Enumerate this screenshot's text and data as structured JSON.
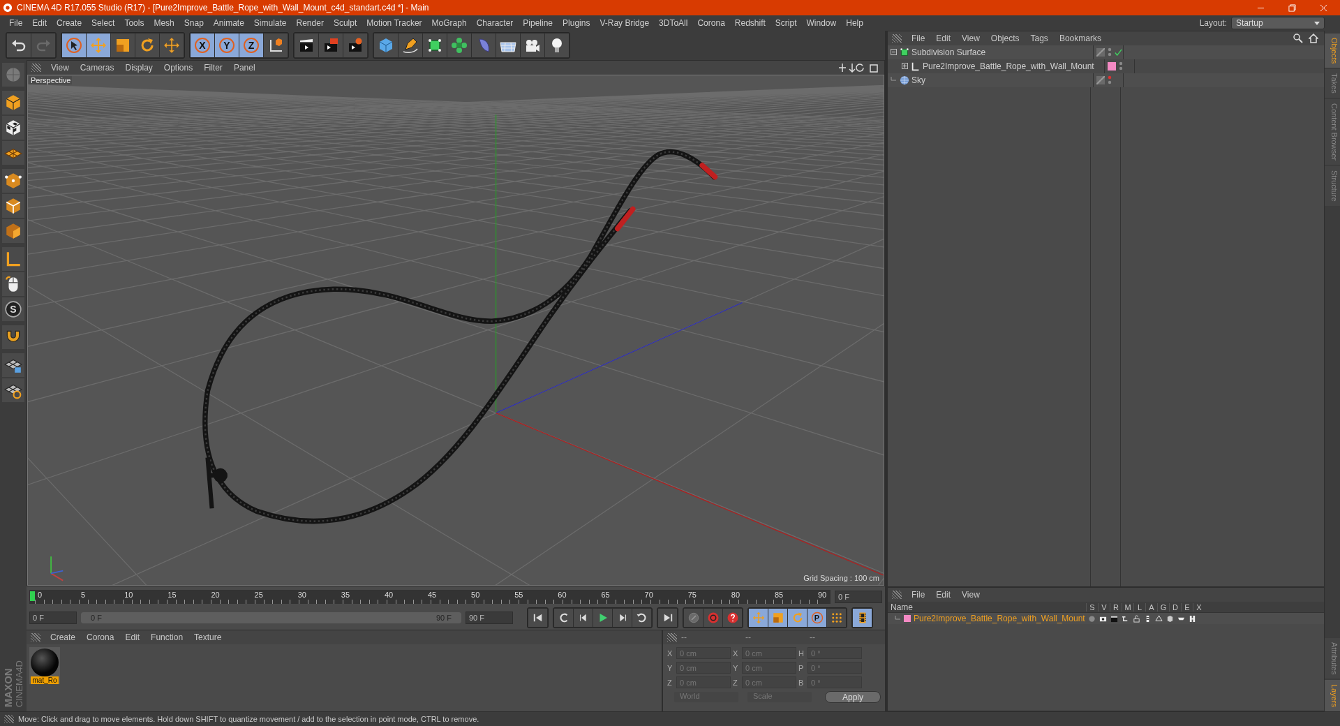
{
  "window": {
    "title": "CINEMA 4D R17.055 Studio (R17) - [Pure2Improve_Battle_Rope_with_Wall_Mount_c4d_standart.c4d *] - Main"
  },
  "menu": [
    "File",
    "Edit",
    "Create",
    "Select",
    "Tools",
    "Mesh",
    "Snap",
    "Animate",
    "Simulate",
    "Render",
    "Sculpt",
    "Motion Tracker",
    "MoGraph",
    "Character",
    "Pipeline",
    "Plugins",
    "V-Ray Bridge",
    "3DToAll",
    "Corona",
    "Redshift",
    "Script",
    "Window",
    "Help"
  ],
  "layout": {
    "label": "Layout:",
    "value": "Startup"
  },
  "toolbar": [
    [
      {
        "kind": "undo",
        "selected": false
      },
      {
        "kind": "redo",
        "selected": false
      }
    ],
    [
      {
        "kind": "cursor",
        "selected": true
      },
      {
        "kind": "move",
        "selected": true
      },
      {
        "kind": "scale",
        "selected": false
      },
      {
        "kind": "rotate",
        "selected": false
      },
      {
        "kind": "transform",
        "selected": false
      }
    ],
    [
      {
        "kind": "axis",
        "label": "X",
        "selected": true
      },
      {
        "kind": "axis",
        "label": "Y",
        "selected": true
      },
      {
        "kind": "axis",
        "label": "Z",
        "selected": true
      },
      {
        "kind": "coords",
        "selected": false
      }
    ],
    [
      {
        "kind": "render-view",
        "selected": false
      },
      {
        "kind": "render-picture",
        "selected": false
      },
      {
        "kind": "render-settings",
        "selected": false
      }
    ],
    [
      {
        "kind": "cube",
        "selected": false
      },
      {
        "kind": "pen",
        "selected": false
      },
      {
        "kind": "subdivision",
        "selected": false
      },
      {
        "kind": "cloner",
        "selected": false
      },
      {
        "kind": "bend",
        "selected": false
      },
      {
        "kind": "floor",
        "selected": false
      },
      {
        "kind": "camera",
        "selected": false
      },
      {
        "kind": "light",
        "selected": false
      }
    ]
  ],
  "left_toolbar": [
    [
      {
        "kind": "sphere"
      }
    ],
    [
      {
        "kind": "model"
      },
      {
        "kind": "texture"
      },
      {
        "kind": "workplane"
      }
    ],
    [
      {
        "kind": "points"
      },
      {
        "kind": "edges"
      },
      {
        "kind": "polygons"
      }
    ],
    [
      {
        "kind": "axis-mode"
      },
      {
        "kind": "mouse"
      },
      {
        "kind": "snap",
        "label": "S"
      }
    ],
    [
      {
        "kind": "magnet"
      }
    ],
    [
      {
        "kind": "grid-lock"
      },
      {
        "kind": "grid-snap"
      }
    ]
  ],
  "viewport": {
    "menu": [
      "View",
      "Cameras",
      "Display",
      "Options",
      "Filter",
      "Panel"
    ],
    "camera": "Perspective",
    "grid_spacing": "Grid Spacing : 100 cm"
  },
  "timeline": {
    "ticks": [
      "0",
      "5",
      "10",
      "15",
      "20",
      "25",
      "30",
      "35",
      "40",
      "45",
      "50",
      "55",
      "60",
      "65",
      "70",
      "75",
      "80",
      "85",
      "90"
    ],
    "current": "0 F",
    "start": "0 F",
    "range": {
      "start": "0 F",
      "end": "90 F",
      "level": 1
    },
    "end": "90 F",
    "buttons": [
      [
        {
          "kind": "first",
          "selected": false
        }
      ],
      [
        {
          "kind": "prev-key",
          "selected": false
        },
        {
          "kind": "prev",
          "selected": false
        },
        {
          "kind": "play",
          "selected": false
        },
        {
          "kind": "next",
          "selected": false
        },
        {
          "kind": "next-key",
          "selected": false
        }
      ],
      [
        {
          "kind": "last",
          "selected": false
        }
      ],
      [
        {
          "kind": "key",
          "selected": false
        },
        {
          "kind": "record",
          "selected": false
        },
        {
          "kind": "autokey",
          "selected": false
        }
      ],
      [
        {
          "kind": "move",
          "selected": true
        },
        {
          "kind": "scale",
          "selected": true
        },
        {
          "kind": "rotate",
          "selected": true
        },
        {
          "kind": "param",
          "label": "P",
          "selected": true
        },
        {
          "kind": "dots",
          "selected": false
        }
      ],
      [
        {
          "kind": "film",
          "selected": true
        }
      ]
    ]
  },
  "materials": {
    "menu": [
      "Create",
      "Corona",
      "Edit",
      "Function",
      "Texture"
    ],
    "items": [
      {
        "name": "mat_Ro",
        "selected": true
      }
    ]
  },
  "coordinates": {
    "headers": [
      "--",
      "--",
      "--"
    ],
    "rows": [
      {
        "a": "X",
        "position": "0 cm",
        "b": "X",
        "size": "0 cm",
        "c": "H",
        "rotation": "0 °"
      },
      {
        "a": "Y",
        "position": "0 cm",
        "b": "Y",
        "size": "0 cm",
        "c": "P",
        "rotation": "0 °"
      },
      {
        "a": "Z",
        "position": "0 cm",
        "b": "Z",
        "size": "0 cm",
        "c": "B",
        "rotation": "0 °"
      }
    ],
    "mode": "World",
    "size_mode": "Scale",
    "apply": "Apply"
  },
  "objects": {
    "menu": [
      "File",
      "Edit",
      "View",
      "Objects",
      "Tags",
      "Bookmarks"
    ],
    "tree": [
      {
        "name": "Subdivision Surface",
        "kind": "subdivision",
        "expanded": true,
        "editor_hidden": false,
        "enabled": true,
        "children": [
          {
            "name": "Pure2Improve_Battle_Rope_with_Wall_Mount",
            "kind": "null",
            "expanded": false,
            "editor_hidden": false,
            "enabled": false,
            "color": "#f48ac4"
          }
        ]
      },
      {
        "name": "Sky",
        "kind": "sky",
        "editor_hidden": true,
        "enabled": false
      }
    ]
  },
  "layers": {
    "menu": [
      "File",
      "Edit",
      "View"
    ],
    "columns": [
      "Name",
      "S",
      "V",
      "R",
      "M",
      "L",
      "A",
      "G",
      "D",
      "E",
      "X"
    ],
    "rows": [
      {
        "name": "Pure2Improve_Battle_Rope_with_Wall_Mount",
        "color": "#f48ac4"
      }
    ]
  },
  "side_tabs_top": [
    {
      "label": "Objects",
      "selected": true
    },
    {
      "label": "Takes",
      "selected": false
    },
    {
      "label": "Content Browser",
      "selected": false
    },
    {
      "label": "Structure",
      "selected": false
    }
  ],
  "side_tabs_bottom": [
    {
      "label": "Attributes",
      "selected": false
    },
    {
      "label": "Layers",
      "selected": true
    }
  ],
  "logo": [
    "MAXON",
    "CINEMA4D"
  ],
  "status": "Move: Click and drag to move elements. Hold down SHIFT to quantize movement / add to the selection in point mode, CTRL to remove."
}
